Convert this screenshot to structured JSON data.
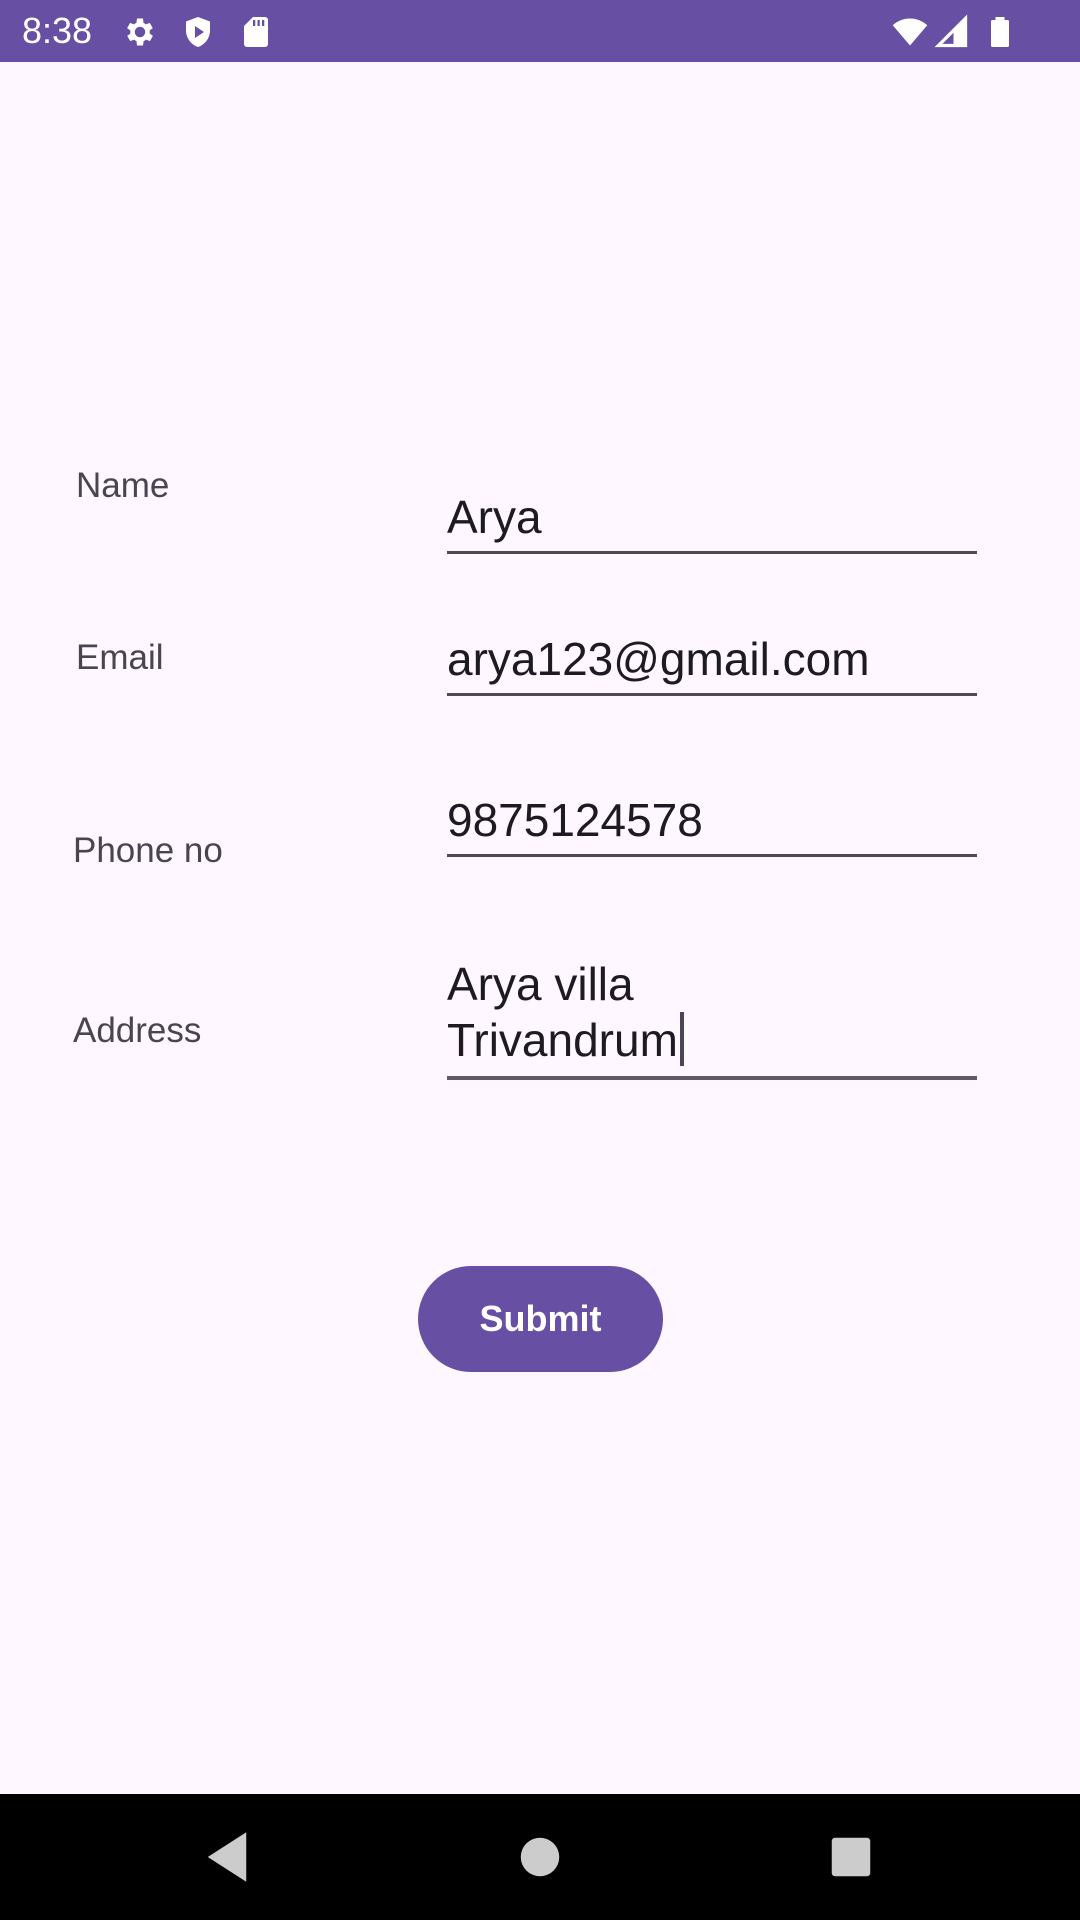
{
  "status_bar": {
    "time": "8:38",
    "icons": [
      "settings-icon",
      "shield-icon",
      "sd-card-icon",
      "wifi-icon",
      "signal-icon",
      "battery-icon"
    ],
    "background": "#6750A4"
  },
  "form": {
    "name": {
      "label": "Name",
      "value": "Arya"
    },
    "email": {
      "label": "Email",
      "value": "arya123@gmail.com"
    },
    "phone": {
      "label": "Phone no",
      "value": "9875124578"
    },
    "address": {
      "label": "Address",
      "value_line1": "Arya villa",
      "value_line2": "Trivandrum"
    }
  },
  "submit_button": {
    "label": "Submit",
    "color": "#6750A4"
  },
  "nav_bar": {
    "icons": [
      "back-icon",
      "home-icon",
      "recents-icon"
    ]
  }
}
